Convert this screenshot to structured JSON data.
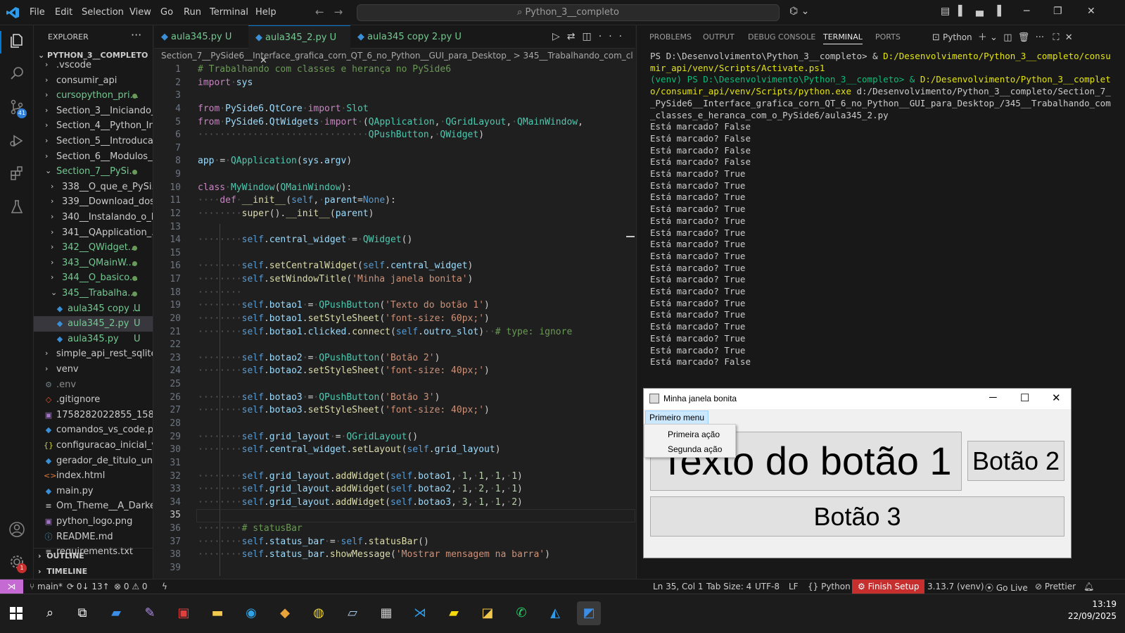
{
  "titlebar": {
    "menus": [
      "File",
      "Edit",
      "Selection",
      "View",
      "Go",
      "Run",
      "Terminal",
      "Help"
    ],
    "search": "Python_3__completo"
  },
  "activity": {
    "source_control_badge": "41",
    "settings_badge": "1"
  },
  "explorer": {
    "title": "EXPLORER",
    "root": "PYTHON_3__COMPLETO",
    "items": [
      {
        "label": ".vscode"
      },
      {
        "label": "consumir_api"
      },
      {
        "label": "cursopython_pri..."
      },
      {
        "label": "Section_3__Iniciando_..."
      },
      {
        "label": "Section_4__Python_In..."
      },
      {
        "label": "Section_5__Introduca..."
      },
      {
        "label": "Section_6__Modulos_..."
      },
      {
        "label": "Section_7__PySi..."
      },
      {
        "label": "338__O_que_e_PySi..."
      },
      {
        "label": "339__Download_dos..."
      },
      {
        "label": "340__Instalando_o_P..."
      },
      {
        "label": "341__QApplication_..."
      },
      {
        "label": "342__QWidget..."
      },
      {
        "label": "343__QMainW..."
      },
      {
        "label": "344__O_basico..."
      },
      {
        "label": "345__Trabalha..."
      },
      {
        "label": "aula345 copy ...",
        "mark": "U"
      },
      {
        "label": "aula345_2.py",
        "mark": "U"
      },
      {
        "label": "aula345.py",
        "mark": "U"
      },
      {
        "label": "simple_api_rest_sqlite..."
      },
      {
        "label": "venv"
      },
      {
        "label": ".env"
      },
      {
        "label": ".gitignore"
      },
      {
        "label": "1758282022855_1588..."
      },
      {
        "label": "comandos_vs_code.py"
      },
      {
        "label": "configuracao_inicial_v..."
      },
      {
        "label": "gerador_de_titulo_un..."
      },
      {
        "label": "index.html"
      },
      {
        "label": "main.py"
      },
      {
        "label": "Om_Theme__A_Darke..."
      },
      {
        "label": "python_logo.png"
      },
      {
        "label": "README.md"
      },
      {
        "label": "requirements.txt"
      }
    ],
    "outline": "OUTLINE",
    "timeline": "TIMELINE"
  },
  "editor": {
    "tabs": [
      {
        "label": "aula345.py",
        "mark": "U"
      },
      {
        "label": "aula345_2.py",
        "mark": "U"
      },
      {
        "label": "aula345 copy 2.py",
        "mark": "U"
      }
    ],
    "breadcrumb": "Section_7__PySide6__Interface_grafica_corn_QT_6_no_Python__GUI_para_Desktop_ > 345__Trabalhando_com_classes_e",
    "lines": [
      "# Trabalhando com classes e herança no PySide6",
      "import sys",
      "",
      "from PySide6.QtCore import Slot",
      "from PySide6.QtWidgets import (QApplication, QGridLayout, QMainWindow,",
      "                               QPushButton, QWidget)",
      "",
      "app = QApplication(sys.argv)",
      "",
      "class MyWindow(QMainWindow):",
      "    def __init__(self, parent=None):",
      "        super().__init__(parent)",
      "",
      "        self.central_widget = QWidget()",
      "",
      "        self.setCentralWidget(self.central_widget)",
      "        self.setWindowTitle('Minha janela bonita')",
      "        ",
      "        self.botao1 = QPushButton('Texto do botão 1')",
      "        self.botao1.setStyleSheet('font-size: 60px;')",
      "        self.botao1.clicked.connect(self.outro_slot)  # type: ignore",
      "",
      "        self.botao2 = QPushButton('Botão 2')",
      "        self.botao2.setStyleSheet('font-size: 40px;')",
      "",
      "        self.botao3 = QPushButton('Botão 3')",
      "        self.botao3.setStyleSheet('font-size: 40px;')",
      "",
      "        self.grid_layout = QGridLayout()",
      "        self.central_widget.setLayout(self.grid_layout)",
      "",
      "        self.grid_layout.addWidget(self.botao1, 1, 1, 1, 1)",
      "        self.grid_layout.addWidget(self.botao2, 1, 2, 1, 1)",
      "        self.grid_layout.addWidget(self.botao3, 3, 1, 1, 2)",
      "",
      "        # statusBar",
      "        self.status_bar = self.statusBar()",
      "        self.status_bar.showMessage('Mostrar mensagem na barra')",
      ""
    ]
  },
  "panel": {
    "tabs": [
      "PROBLEMS",
      "OUTPUT",
      "DEBUG CONSOLE",
      "TERMINAL",
      "PORTS"
    ],
    "active_tab": "TERMINAL",
    "terminal_name": "Python",
    "terminal": {
      "prompt1_prefix": "PS D:\\Desenvolvimento\\Python_3__completo> & ",
      "prompt1_path": "D:/Desenvolvimento/Python_3__completo/consumir_api/venv/Scripts/Activate.ps1",
      "prompt2_prefix": "(venv) PS D:\\Desenvolvimento\\Python_3__completo> & ",
      "prompt2_path": "D:/Desenvolvimento/Python_3__completo/consumir_api/venv/Scripts/python.exe",
      "prompt2_arg": " d:/Desenvolvimento/Python_3__completo/Section_7__PySide6__Interface_grafica_corn_QT_6_no_Python__GUI_para_Desktop_/345__Trabalhando_com_classes_e_heranca_com_o_PySide6/aula345_2.py",
      "output": [
        "Está marcado? False",
        "Está marcado? False",
        "Está marcado? False",
        "Está marcado? False",
        "Está marcado? True",
        "Está marcado? True",
        "Está marcado? True",
        "Está marcado? True",
        "Está marcado? True",
        "Está marcado? True",
        "Está marcado? True",
        "Está marcado? True",
        "Está marcado? True",
        "Está marcado? True",
        "Está marcado? True",
        "Está marcado? True",
        "Está marcado? True",
        "Está marcado? True",
        "Está marcado? True",
        "Está marcado? True",
        "Está marcado? False"
      ]
    }
  },
  "qtwindow": {
    "title": "Minha janela bonita",
    "menu": "Primeiro menu",
    "actions": [
      "Primeira ação",
      "Segunda ação"
    ],
    "botao1": "Texto do botão 1",
    "botao2": "Botão 2",
    "botao3": "Botão 3"
  },
  "statusbar": {
    "branch": "main*",
    "sync": "0↓ 13↑",
    "errors": "0",
    "warnings": "0",
    "position": "Ln 35, Col 1",
    "tab_size": "Tab Size: 4",
    "encoding": "UTF-8",
    "eol": "LF",
    "language": "Python",
    "finish_setup": "Finish Setup",
    "interpreter": "3.13.7 (venv)",
    "go_live": "Go Live",
    "prettier": "Prettier"
  },
  "taskbar": {
    "time": "13:19",
    "date": "22/09/2025"
  },
  "colors": {
    "accent": "#0078d4",
    "remote": "#c56ad3",
    "finish_setup": "#c72e2e",
    "untracked": "#73c991"
  }
}
